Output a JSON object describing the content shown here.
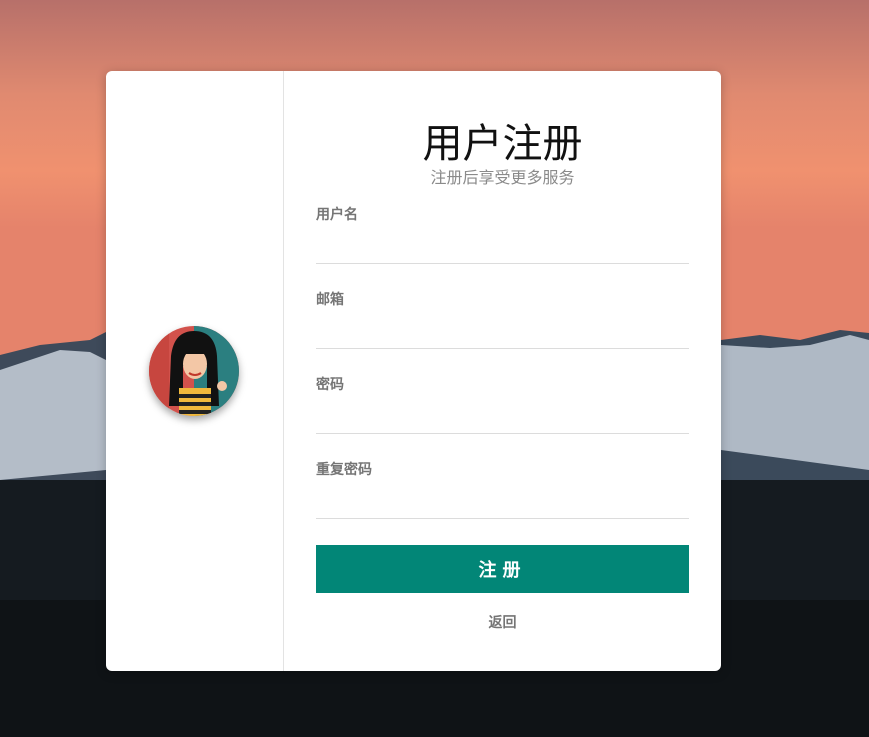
{
  "colors": {
    "primary_button": "#028677",
    "card_background": "#ffffff",
    "label_text": "#757575",
    "subtitle_text": "#8a8a8a"
  },
  "form": {
    "title": "用户注册",
    "subtitle": "注册后享受更多服务",
    "fields": [
      {
        "label": "用户名",
        "value": "",
        "placeholder": ""
      },
      {
        "label": "邮箱",
        "value": "",
        "placeholder": ""
      },
      {
        "label": "密码",
        "value": "",
        "placeholder": ""
      },
      {
        "label": "重复密码",
        "value": "",
        "placeholder": ""
      }
    ],
    "submit_label": "注册",
    "back_label": "返回"
  },
  "avatar": {
    "icon": "user-avatar-illustration"
  }
}
